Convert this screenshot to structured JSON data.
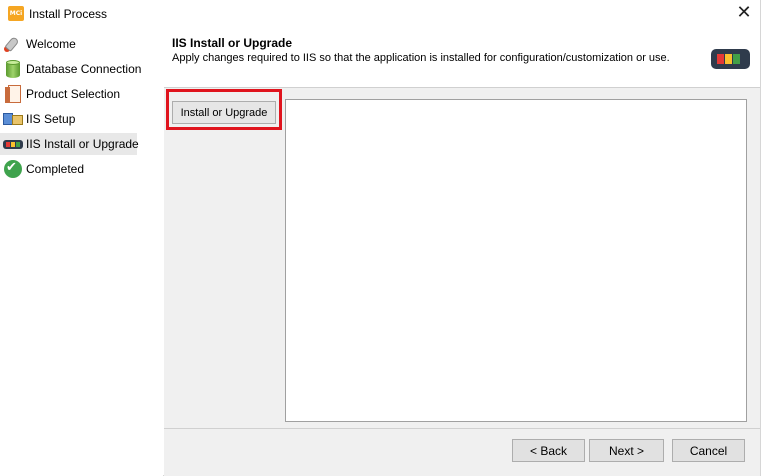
{
  "window": {
    "title": "Install Process",
    "app_icon_text": "MCi",
    "close_glyph": "✕"
  },
  "steps": [
    {
      "label": "Welcome",
      "icon": "rocket-icon",
      "active": false
    },
    {
      "label": "Database Connection",
      "icon": "database-icon",
      "active": false
    },
    {
      "label": "Product Selection",
      "icon": "product-icon",
      "active": false
    },
    {
      "label": "IIS Setup",
      "icon": "iis-icon",
      "active": false
    },
    {
      "label": "IIS Install or Upgrade",
      "icon": "server-icon",
      "active": true
    },
    {
      "label": "Completed",
      "icon": "check-icon",
      "active": false
    }
  ],
  "header": {
    "title": "IIS Install or Upgrade",
    "description": "Apply changes required to IIS so that the application is installed for configuration/customization or use.",
    "icon": "server-status-icon",
    "icon_colors": [
      "#e53935",
      "#fbc02d",
      "#43a047"
    ]
  },
  "main": {
    "action_button_label": "Install or Upgrade",
    "highlight_color": "#e0141e"
  },
  "footer": {
    "back_label": "< Back",
    "next_label": "Next >",
    "cancel_label": "Cancel"
  }
}
